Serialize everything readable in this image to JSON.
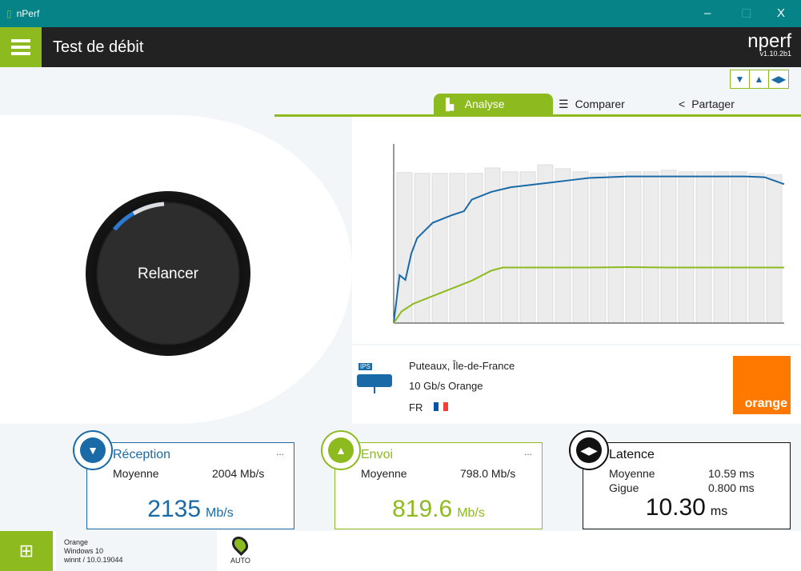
{
  "window": {
    "title": "nPerf",
    "minimize": "–",
    "maximize": "☐",
    "close": "X"
  },
  "header": {
    "title": "Test de débit",
    "logo": "nperf",
    "version": "v1.10.2b1"
  },
  "toggles": [
    "▼",
    "▲",
    "◀▶"
  ],
  "tabs": [
    {
      "label": "Analyse",
      "icon": "bar-chart-icon"
    },
    {
      "label": "Comparer",
      "icon": "compare-icon"
    },
    {
      "label": "Partager",
      "icon": "share-icon"
    }
  ],
  "gauge": {
    "label": "Relancer",
    "progress": 0.15
  },
  "server": {
    "badge": "IPS",
    "location": "Puteaux, Île-de-France",
    "name": "10 Gb/s Orange",
    "country": "FR",
    "provider_logo": "orange"
  },
  "cards": {
    "download": {
      "title": "Réception",
      "more": "...",
      "avg_label": "Moyenne",
      "avg": "2004 Mb/s",
      "value": "2135",
      "unit": "Mb/s",
      "color": "#1a6aa8"
    },
    "upload": {
      "title": "Envoi",
      "more": "...",
      "avg_label": "Moyenne",
      "avg": "798.0 Mb/s",
      "value": "819.6",
      "unit": "Mb/s",
      "color": "#8dbb1f"
    },
    "latency": {
      "title": "Latence",
      "avg_label": "Moyenne",
      "avg": "10.59 ms",
      "jitter_label": "Gigue",
      "jitter": "0.800 ms",
      "value": "10.30",
      "unit": "ms",
      "color": "#111111"
    }
  },
  "footer": {
    "isp": "Orange",
    "os": "Windows 10",
    "build": "winnt / 10.0.19044",
    "mode": "AUTO"
  },
  "chart_data": {
    "type": "line",
    "ylim": [
      0,
      2300
    ],
    "bars": [
      1950,
      1940,
      1940,
      1940,
      1940,
      2010,
      1960,
      1960,
      2050,
      2000,
      1960,
      1940,
      1950,
      1960,
      1960,
      1980,
      1960,
      1960,
      1960,
      1960,
      1940,
      1920
    ],
    "series": [
      {
        "name": "Réception",
        "color": "#1a6aa8",
        "values": [
          [
            0,
            0
          ],
          [
            0.015,
            620
          ],
          [
            0.03,
            560
          ],
          [
            0.045,
            900
          ],
          [
            0.06,
            1100
          ],
          [
            0.1,
            1300
          ],
          [
            0.15,
            1400
          ],
          [
            0.18,
            1450
          ],
          [
            0.2,
            1600
          ],
          [
            0.25,
            1700
          ],
          [
            0.3,
            1760
          ],
          [
            0.4,
            1820
          ],
          [
            0.45,
            1850
          ],
          [
            0.5,
            1880
          ],
          [
            0.6,
            1900
          ],
          [
            0.7,
            1900
          ],
          [
            0.8,
            1900
          ],
          [
            0.9,
            1900
          ],
          [
            0.95,
            1890
          ],
          [
            1,
            1800
          ]
        ]
      },
      {
        "name": "Envoi",
        "color": "#8dbb1f",
        "values": [
          [
            0,
            0
          ],
          [
            0.02,
            150
          ],
          [
            0.05,
            250
          ],
          [
            0.1,
            350
          ],
          [
            0.15,
            450
          ],
          [
            0.2,
            550
          ],
          [
            0.25,
            680
          ],
          [
            0.28,
            720
          ],
          [
            0.3,
            720
          ],
          [
            0.4,
            720
          ],
          [
            0.5,
            720
          ],
          [
            0.6,
            725
          ],
          [
            0.7,
            720
          ],
          [
            0.8,
            720
          ],
          [
            0.9,
            720
          ],
          [
            1,
            720
          ]
        ]
      }
    ]
  }
}
